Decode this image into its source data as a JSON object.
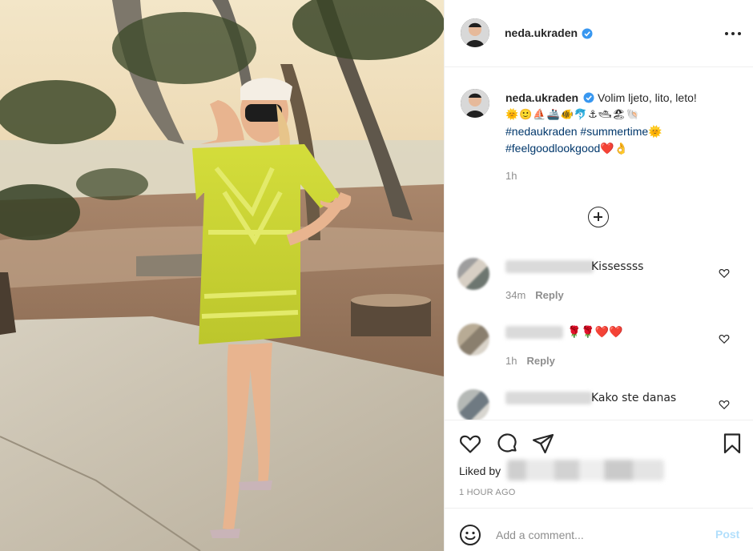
{
  "header": {
    "username": "neda.ukraden",
    "verified": true
  },
  "caption": {
    "username": "neda.ukraden",
    "text": "Volim ljeto, lito, leto!",
    "emojis": "🌞🙂⛵🚢🐠🐬⚓🛥🏖🐚",
    "hashtags_line1": "#nedaukraden #summertime🌞",
    "hashtags_line2": "#feelgoodlookgood❤️👌",
    "time": "1h"
  },
  "comments": [
    {
      "text": "Kissessss",
      "time": "34m",
      "reply_label": "Reply"
    },
    {
      "text": "🌹🌹❤️❤️",
      "time": "1h",
      "reply_label": "Reply"
    },
    {
      "text": "Kako ste danas",
      "time": "",
      "reply_label": ""
    }
  ],
  "likes": {
    "liked_by_label": "Liked by"
  },
  "timestamp": "1 HOUR AGO",
  "add_comment": {
    "placeholder": "Add a comment...",
    "post_label": "Post"
  },
  "colors": {
    "link_blue": "#00376b",
    "verified_blue": "#3897f0",
    "post_disabled": "#b2dffc",
    "muted": "#8e8e8e"
  }
}
